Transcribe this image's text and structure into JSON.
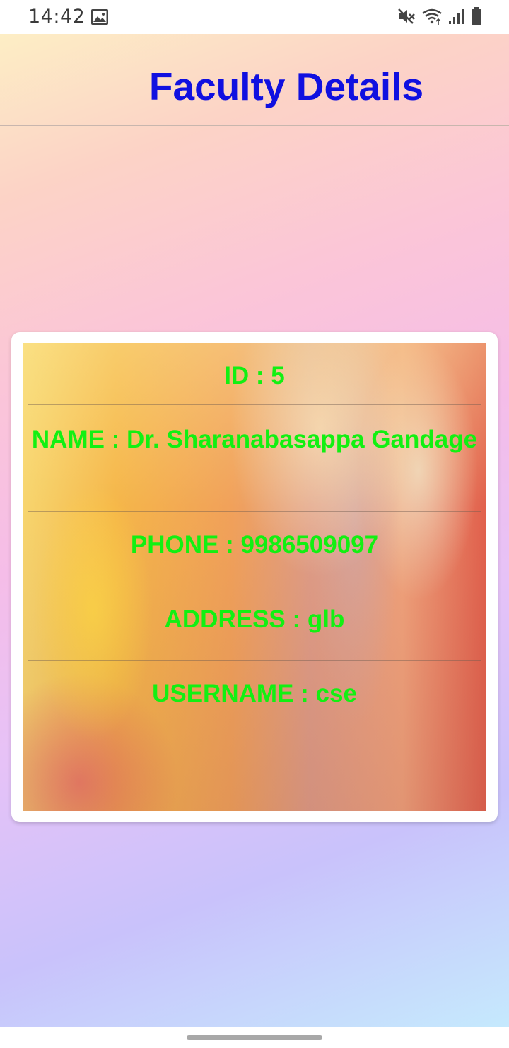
{
  "status_bar": {
    "time": "14:42",
    "icons": [
      "image-icon",
      "mute-icon",
      "wifi-icon",
      "signal-icon",
      "battery-icon"
    ]
  },
  "app": {
    "title": "Faculty Details",
    "title_color": "#1010e0",
    "value_color": "#12f012"
  },
  "faculty": {
    "id": "ID : 5",
    "name": "NAME : Dr. Sharanabasappa Gandage",
    "phone": "PHONE : 9986509097",
    "address": "ADDRESS : glb",
    "username": "USERNAME : cse"
  }
}
